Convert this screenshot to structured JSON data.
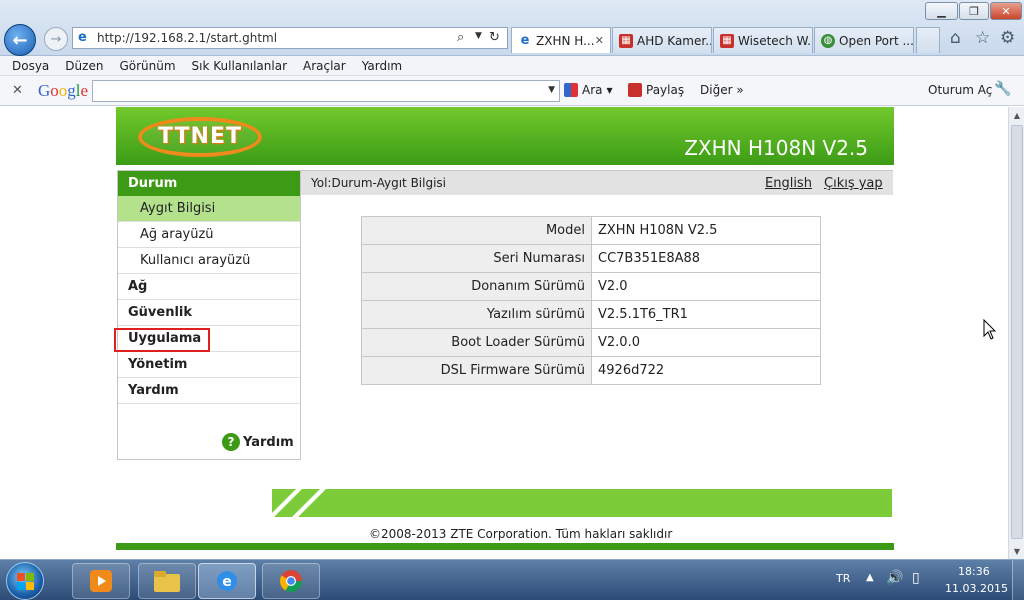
{
  "browser": {
    "address_url": "http://192.168.2.1/start.ghtml",
    "tabs": [
      {
        "label": "ZXHN H...",
        "icon": "ie-page-icon",
        "active": true
      },
      {
        "label": "AHD Kamer...",
        "icon": "camera-site-icon",
        "active": false
      },
      {
        "label": "Wisetech W...",
        "icon": "camera-site-icon",
        "active": false
      },
      {
        "label": "Open Port ...",
        "icon": "globe-icon",
        "active": false
      }
    ],
    "menu": [
      "Dosya",
      "Düzen",
      "Görünüm",
      "Sık Kullanılanlar",
      "Araçlar",
      "Yardım"
    ],
    "google_toolbar": {
      "logo": "Google",
      "search_label": "Ara",
      "share_label": "Paylaş",
      "more_label": "Diğer »",
      "signin_label": "Oturum Aç"
    }
  },
  "router_page": {
    "logo_text": "TTNET",
    "device_title": "ZXHN H108N V2.5",
    "sidebar": {
      "header": "Durum",
      "subitems": [
        "Aygıt Bilgisi",
        "Ağ arayüzü",
        "Kullanıcı arayüzü"
      ],
      "active_subitem": "Aygıt Bilgisi",
      "main_items": [
        "Ağ",
        "Güvenlik",
        "Uygulama",
        "Yönetim",
        "Yardım"
      ],
      "highlighted_item": "Uygulama",
      "help_label": "Yardım"
    },
    "path": "Yol:Durum-Aygıt Bilgisi",
    "language_link": "English",
    "logout_link": "Çıkış yap",
    "device_info": [
      {
        "label": "Model",
        "value": "ZXHN H108N V2.5"
      },
      {
        "label": "Seri Numarası",
        "value": "CC7B351E8A88"
      },
      {
        "label": "Donanım Sürümü",
        "value": "V2.0"
      },
      {
        "label": "Yazılım sürümü",
        "value": "V2.5.1T6_TR1"
      },
      {
        "label": "Boot Loader Sürümü",
        "value": "V2.0.0"
      },
      {
        "label": "DSL Firmware Sürümü",
        "value": "4926d722"
      }
    ],
    "copyright": "©2008-2013 ZTE Corporation. Tüm hakları saklıdır"
  },
  "taskbar": {
    "language": "TR",
    "time": "18:36",
    "date": "11.03.2015"
  },
  "colors": {
    "brand_green": "#3d9a15",
    "light_green": "#b4e28c",
    "ttnet_orange": "#f08a1a",
    "highlight_red": "#e02020"
  }
}
